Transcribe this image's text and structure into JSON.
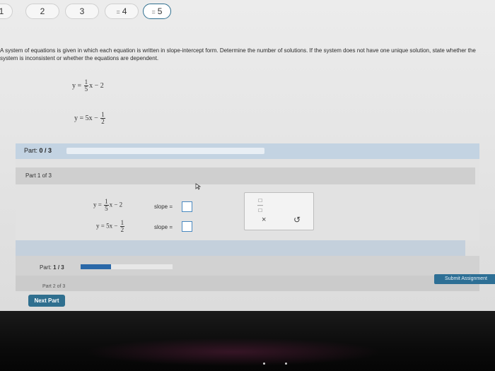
{
  "question_nav": {
    "items": [
      {
        "label": "1",
        "prefix": ""
      },
      {
        "label": "2",
        "prefix": ""
      },
      {
        "label": "3",
        "prefix": ""
      },
      {
        "label": "4",
        "prefix": "="
      },
      {
        "label": "5",
        "prefix": "="
      }
    ]
  },
  "prompt": {
    "text": "A system of equations is given in which each equation is written in slope-intercept form. Determine the number of solutions. If the system does not have one unique solution, state whether the system is inconsistent or whether the equations are dependent."
  },
  "system": {
    "eq1": {
      "lhs": "y =",
      "frac_num": "1",
      "frac_den": "5",
      "rest": "x − 2"
    },
    "eq2": {
      "lhs": "y = 5x −",
      "frac_num": "1",
      "frac_den": "2"
    }
  },
  "part_status": {
    "label": "Part:",
    "value": "0 / 3"
  },
  "part1": {
    "header": "Part 1 of 3",
    "slope_label_1": "slope =",
    "slope_label_2": "slope ="
  },
  "toolbox": {
    "fraction_icon": "fraction-icon",
    "clear_icon": "×",
    "undo_icon": "↺"
  },
  "progress": {
    "label": "Part:",
    "value": "1 / 3",
    "fill_fraction": 0.33
  },
  "part2": {
    "header": "Part 2 of 3"
  },
  "buttons": {
    "next_part": "Next Part",
    "submit": "Submit Assignment"
  },
  "colors": {
    "accent": "#2f6f8f",
    "part_bar": "#c3d3e2",
    "input_border": "#4a89c0"
  }
}
